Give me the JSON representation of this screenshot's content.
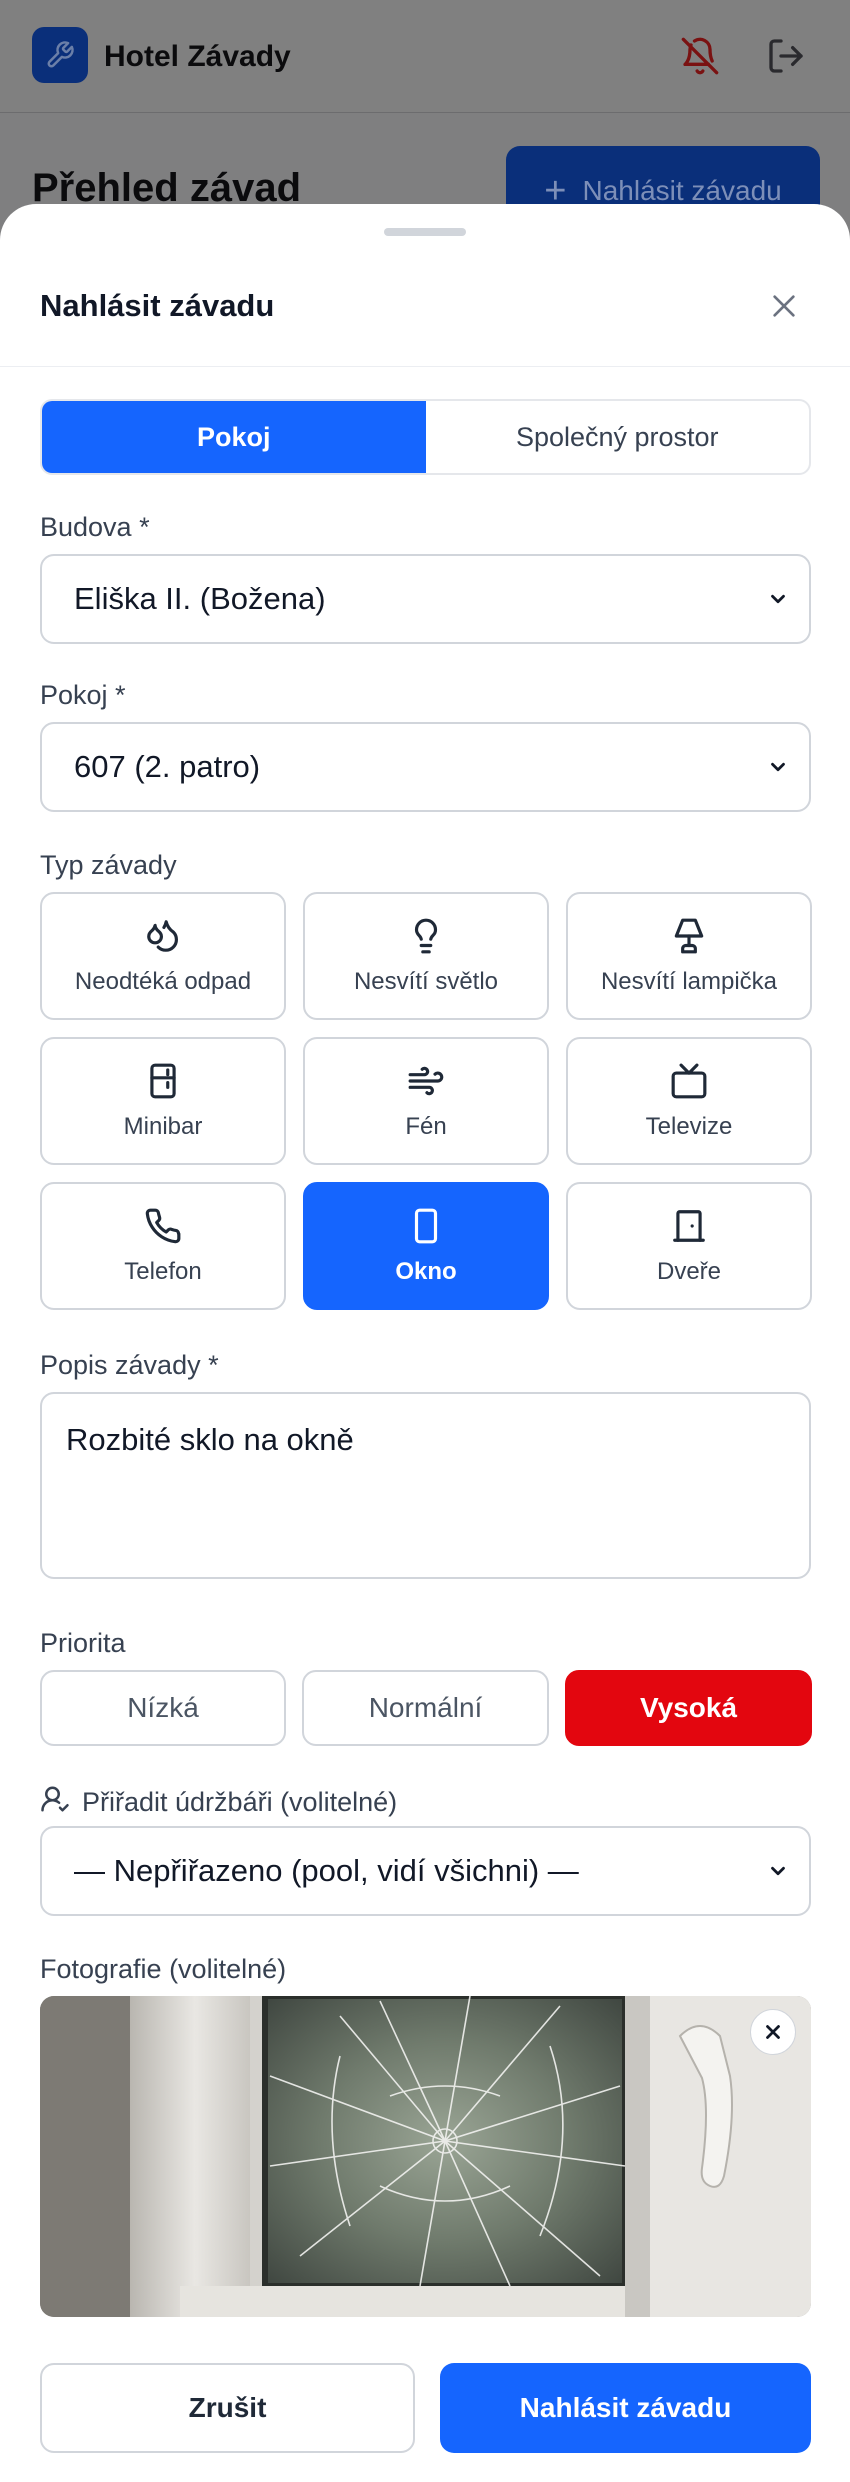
{
  "app": {
    "title": "Hotel Závady"
  },
  "background_page": {
    "title": "Přehled závad",
    "add_button": "Nahlásit závadu"
  },
  "sheet": {
    "title": "Nahlásit závadu",
    "location_tabs": [
      {
        "label": "Pokoj",
        "active": true
      },
      {
        "label": "Společný prostor",
        "active": false
      }
    ],
    "building": {
      "label": "Budova *",
      "value": "Eliška II. (Božena)"
    },
    "room": {
      "label": "Pokoj *",
      "value": "607 (2. patro)"
    },
    "fault_type": {
      "label": "Typ závady",
      "options": [
        {
          "label": "Neodtéká odpad",
          "icon": "droplets-icon",
          "active": false
        },
        {
          "label": "Nesvítí světlo",
          "icon": "lightbulb-icon",
          "active": false
        },
        {
          "label": "Nesvítí lampička",
          "icon": "lamp-icon",
          "active": false
        },
        {
          "label": "Minibar",
          "icon": "fridge-icon",
          "active": false
        },
        {
          "label": "Fén",
          "icon": "wind-icon",
          "active": false
        },
        {
          "label": "Televize",
          "icon": "tv-icon",
          "active": false
        },
        {
          "label": "Telefon",
          "icon": "phone-icon",
          "active": false
        },
        {
          "label": "Okno",
          "icon": "window-icon",
          "active": true
        },
        {
          "label": "Dveře",
          "icon": "door-icon",
          "active": false
        }
      ]
    },
    "description": {
      "label": "Popis závady *",
      "value": "Rozbité sklo na okně"
    },
    "priority": {
      "label": "Priorita",
      "options": [
        {
          "label": "Nízká",
          "active": false
        },
        {
          "label": "Normální",
          "active": false
        },
        {
          "label": "Vysoká",
          "active": true
        }
      ]
    },
    "assign": {
      "label": "Přiřadit údržbáři (volitelné)",
      "value": "— Nepřiřazeno (pool, vidí všichni) —"
    },
    "photo": {
      "label": "Fotografie (volitelné)"
    },
    "buttons": {
      "cancel": "Zrušit",
      "submit": "Nahlásit závadu"
    }
  },
  "colors": {
    "primary": "#1565fe",
    "danger": "#e3060f",
    "border": "#d1d5db"
  }
}
